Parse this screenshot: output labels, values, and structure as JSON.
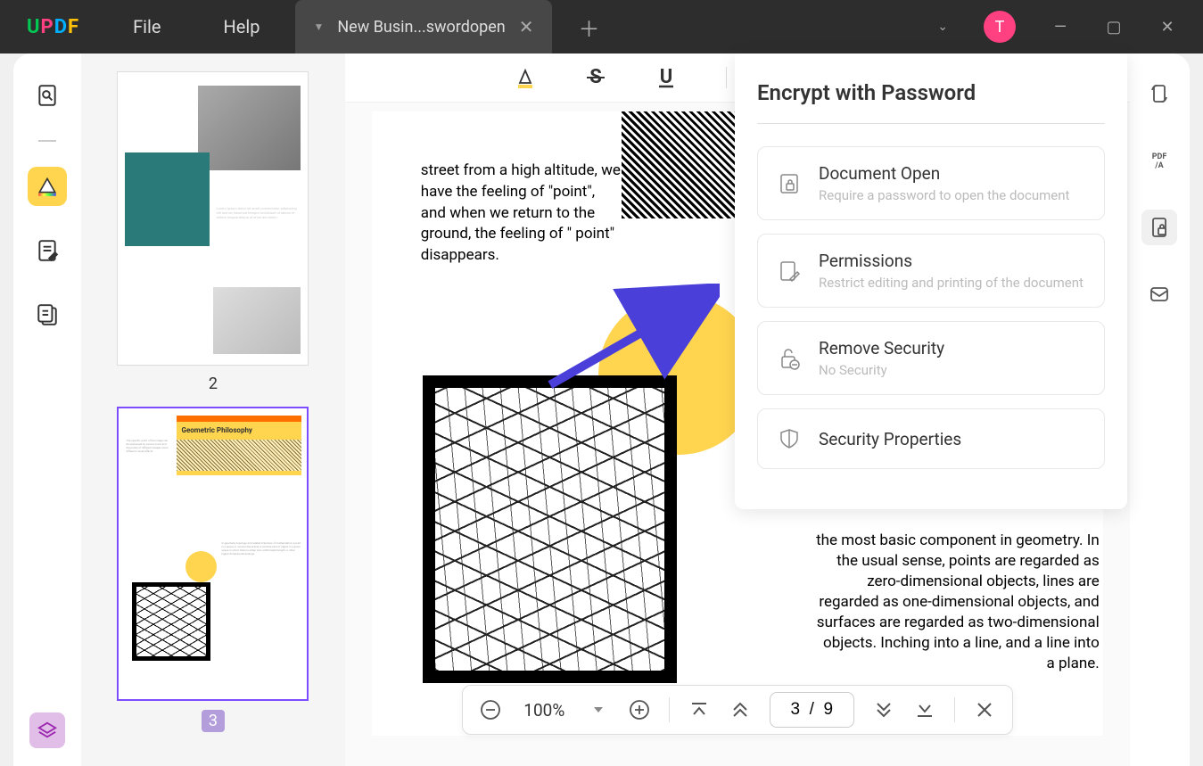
{
  "titlebar": {
    "menus": [
      "File",
      "Help"
    ],
    "tab_title": "New Busin...swordopen",
    "avatar_initial": "T"
  },
  "thumbnails": [
    {
      "num": "2",
      "selected": false
    },
    {
      "num": "3",
      "selected": true,
      "title": "Geometric Philosophy"
    }
  ],
  "document": {
    "top_text": "street from a high altitude, we have the feeling of \"point\", and when we return to the ground, the feeling of \" point\" disappears.",
    "right_text": "the most basic component in geometry. In the usual sense, points are regarded as zero-dimensional objects, lines are regarded as one-dimensional objects, and surfaces are regarded as two-dimensional objects. Inching into a line, and a line into a plane."
  },
  "encrypt_panel": {
    "title": "Encrypt with Password",
    "cards": [
      {
        "title": "Document Open",
        "desc": "Require a password to open the document"
      },
      {
        "title": "Permissions",
        "desc": "Restrict editing and printing of the document"
      },
      {
        "title": "Remove Security",
        "desc": "No Security"
      },
      {
        "title": "Security Properties",
        "desc": ""
      }
    ]
  },
  "bottom_bar": {
    "zoom": "100%",
    "page_display": "3  /  9"
  }
}
